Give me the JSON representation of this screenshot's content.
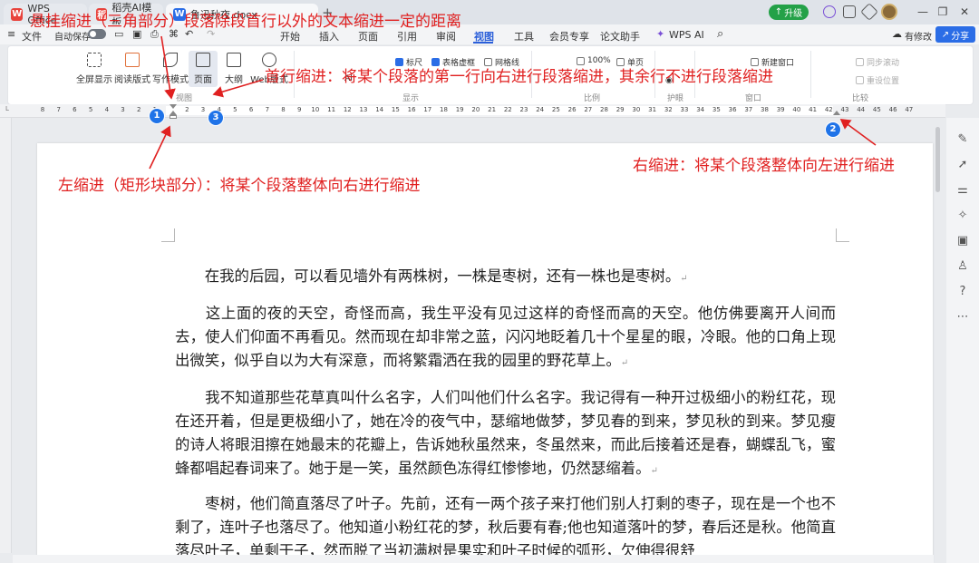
{
  "titlebar": {
    "tabs": [
      {
        "label": "WPS Office",
        "logo": "W"
      },
      {
        "label": "稻壳AI模板",
        "logo": "稻"
      },
      {
        "label": "鲁迅秋夜.docx",
        "logo": "W"
      }
    ],
    "add_tab": "+",
    "upgrade": "升级",
    "win_controls": [
      "—",
      "❐",
      "✕"
    ]
  },
  "menubar": {
    "file": "文件",
    "autosave": "自动保存",
    "items": [
      "开始",
      "插入",
      "页面",
      "引用",
      "审阅",
      "视图",
      "工具",
      "会员专享",
      "论文助手",
      "WPS AI"
    ],
    "review_status": "有修改",
    "share": "分享"
  },
  "ribbon": {
    "view_buttons": [
      "全屏显示",
      "阅读版式",
      "写作模式",
      "页面",
      "大纲",
      "Web版式"
    ],
    "show_checks": [
      {
        "label": "标尺",
        "checked": true
      },
      {
        "label": "表格虚框",
        "checked": true
      },
      {
        "label": "网格线",
        "checked": false
      }
    ],
    "ai_label": "AI",
    "zoom": "100%",
    "single_page": "单页",
    "new_window": "新建窗口",
    "sync_scroll": "同步滚动",
    "reset_pos": "重设位置",
    "groups": [
      "视图",
      "显示",
      "比例",
      "护眼",
      "窗口",
      "比较"
    ]
  },
  "ruler": {
    "ticks": [
      "8",
      "7",
      "6",
      "5",
      "4",
      "3",
      "2",
      "1",
      "",
      "2",
      "3",
      "4",
      "5",
      "6",
      "7",
      "8",
      "9",
      "10",
      "11",
      "12",
      "13",
      "14",
      "15",
      "16",
      "17",
      "18",
      "19",
      "20",
      "21",
      "22",
      "23",
      "24",
      "25",
      "26",
      "27",
      "28",
      "29",
      "30",
      "31",
      "32",
      "33",
      "34",
      "35",
      "36",
      "37",
      "38",
      "39",
      "40",
      "41",
      "42",
      "43",
      "44",
      "45",
      "46",
      "47"
    ]
  },
  "document": {
    "paragraphs": [
      "　　在我的后园，可以看见墙外有两株树，一株是枣树，还有一株也是枣树。",
      "　　这上面的夜的天空，奇怪而高，我生平没有见过这样的奇怪而高的天空。他仿佛要离开人间而去，使人们仰面不再看见。然而现在却非常之蓝，闪闪地眨着几十个星星的眼，冷眼。他的口角上现出微笑，似乎自以为大有深意，而将繁霜洒在我的园里的野花草上。",
      "　　我不知道那些花草真叫什么名字，人们叫他们什么名字。我记得有一种开过极细小的粉红花，现在还开着，但是更极细小了，她在冷的夜气中，瑟缩地做梦，梦见春的到来，梦见秋的到来。梦见瘦的诗人将眼泪擦在她最末的花瓣上，告诉她秋虽然来，冬虽然来，而此后接着还是春，蝴蝶乱飞，蜜蜂都唱起春词来了。她于是一笑，虽然颜色冻得红惨惨地，仍然瑟缩着。",
      "　　枣树，他们简直落尽了叶子。先前，还有一两个孩子来打他们别人打剩的枣子，现在是一个也不剩了，连叶子也落尽了。他知道小粉红花的梦，秋后要有春;他也知道落叶的梦，春后还是秋。他简直落尽叶子，单剩干子，然而脱了当初满树是果实和叶子时候的弧形，欠伸得很舒"
    ],
    "para_mark": "↵"
  },
  "annotations": {
    "hanging": "悬挂缩进（三角部分）段落除段首行以外的文本缩进一定的距离",
    "first_line": "首行缩进：将某个段落的第一行向右进行段落缩进，其余行不进行段落缩进",
    "right": "右缩进：将某个段落整体向左进行缩进",
    "left": "左缩进（矩形块部分）：将某个段落整体向右进行缩进",
    "badges": [
      "1",
      "2",
      "3"
    ]
  },
  "colors": {
    "annotation": "#e02020",
    "accent": "#2b6de6",
    "badge": "#1f73e8"
  }
}
